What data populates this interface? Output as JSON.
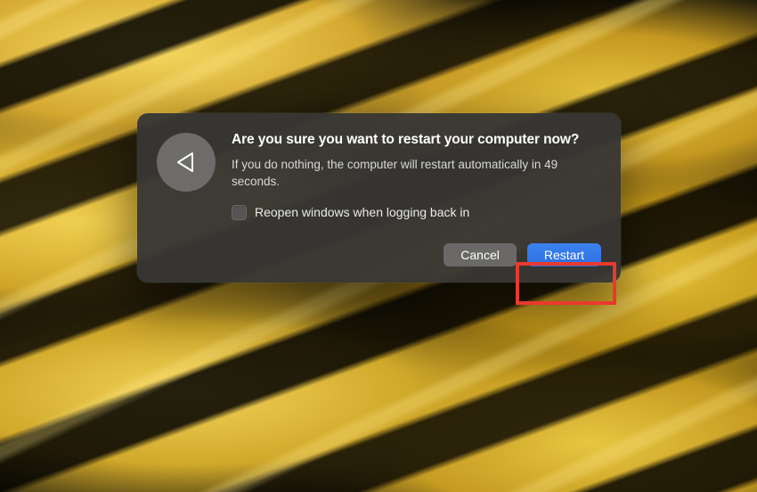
{
  "dialog": {
    "title": "Are you sure you want to restart your computer now?",
    "message": "If you do nothing, the computer will restart automatically in 49 seconds.",
    "checkbox_label": "Reopen windows when logging back in",
    "cancel_label": "Cancel",
    "primary_label": "Restart"
  }
}
